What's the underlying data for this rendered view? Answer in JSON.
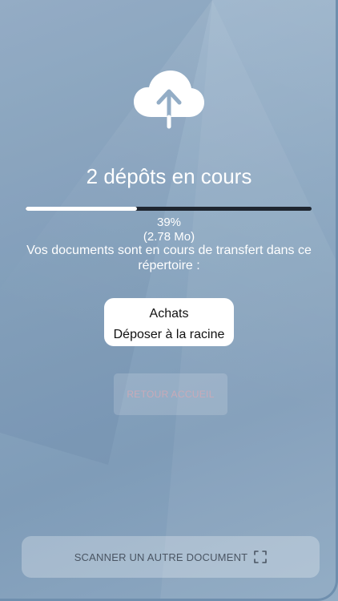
{
  "upload": {
    "title": "2 dépôts en cours",
    "progress_percent": 39,
    "progress_label": "39%",
    "size_label": "(2.78 Mo)",
    "description": "Vos documents sont en cours de transfert dans ce répertoire :"
  },
  "destination": {
    "folder_name": "Achats",
    "action_label": "Déposer à la racine"
  },
  "actions": {
    "home_label": "RETOUR ACCUEIL",
    "scan_label": "SCANNER UN AUTRE DOCUMENT"
  },
  "icons": {
    "upload": "cloud-upload-icon",
    "scan": "scan-frame-icon"
  },
  "colors": {
    "progress_fill": "#ffffff",
    "progress_track": "#1f2630",
    "home_text": "#c9aab8",
    "scan_text": "#4a5563"
  }
}
